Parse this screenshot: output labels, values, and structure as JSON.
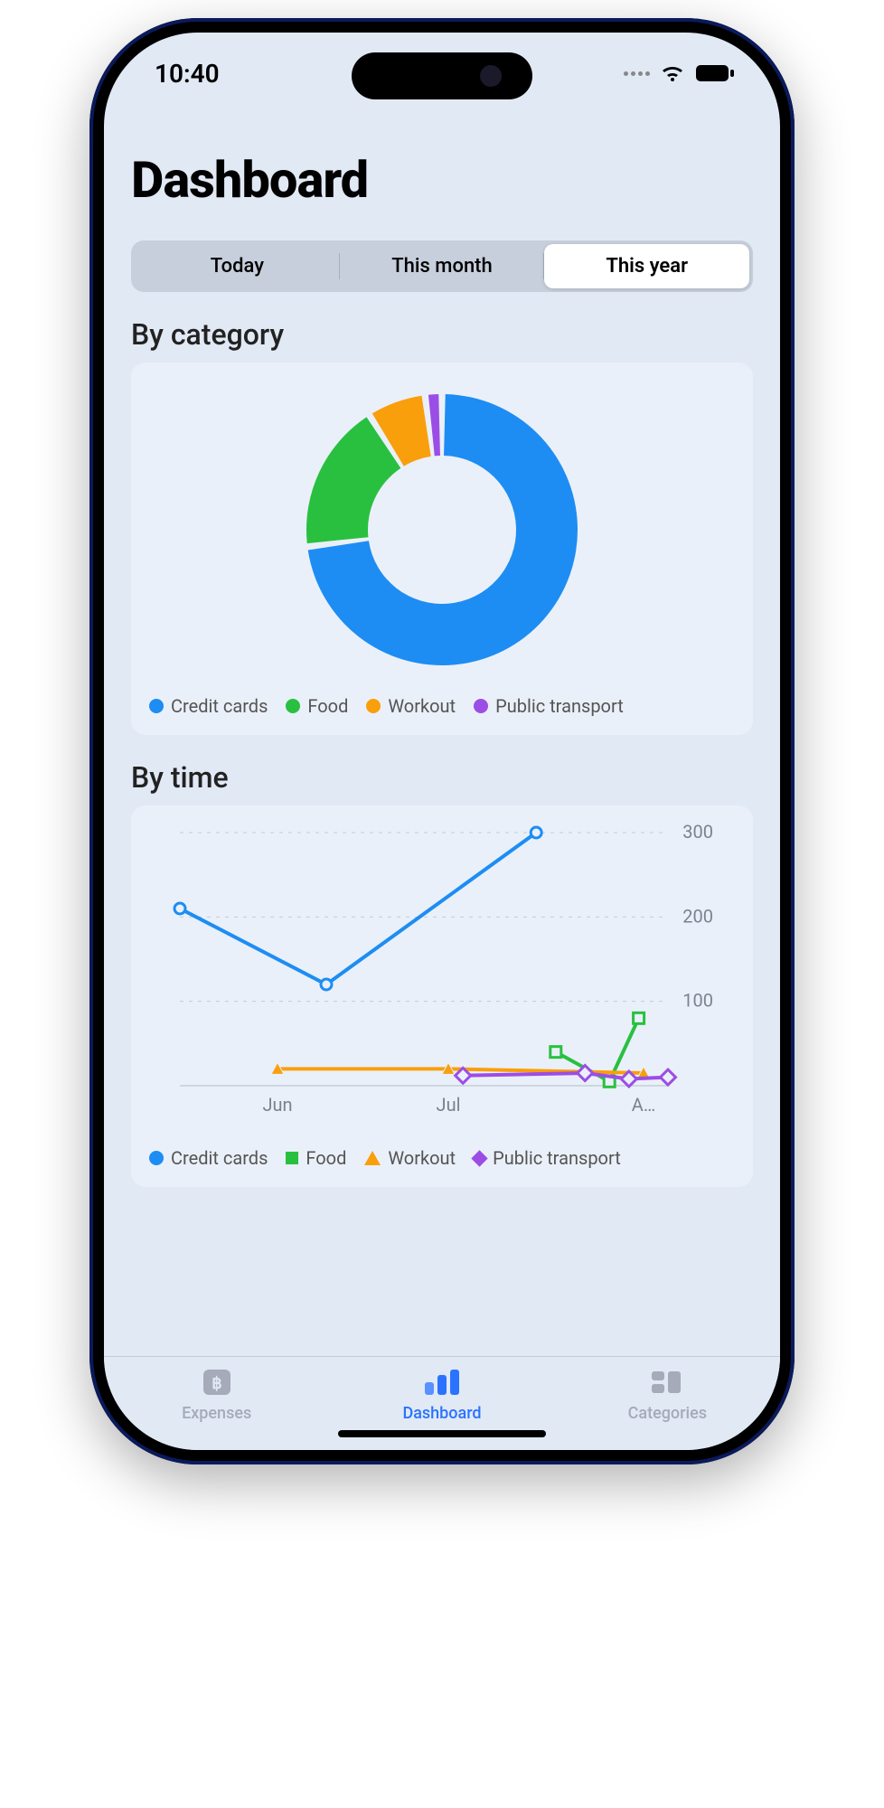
{
  "status": {
    "time": "10:40"
  },
  "title": "Dashboard",
  "segments": {
    "today": "Today",
    "month": "This month",
    "year": "This year",
    "active": 2
  },
  "sections": {
    "by_category": "By category",
    "by_time": "By time"
  },
  "categories": {
    "credit_cards": {
      "label": "Credit cards",
      "color": "#1d8df3"
    },
    "food": {
      "label": "Food",
      "color": "#29c040"
    },
    "workout": {
      "label": "Workout",
      "color": "#f99f0b"
    },
    "transport": {
      "label": "Public transport",
      "color": "#9b4ee5"
    }
  },
  "nav": {
    "expenses": {
      "label": "Expenses"
    },
    "dashboard": {
      "label": "Dashboard"
    },
    "categories": {
      "label": "Categories"
    }
  },
  "chart_data": [
    {
      "type": "pie",
      "title": "By category",
      "series": [
        {
          "name": "Credit cards",
          "value": 73,
          "color": "#1d8df3"
        },
        {
          "name": "Food",
          "value": 18,
          "color": "#29c040"
        },
        {
          "name": "Workout",
          "value": 7,
          "color": "#f99f0b"
        },
        {
          "name": "Public transport",
          "value": 2,
          "color": "#9b4ee5"
        }
      ]
    },
    {
      "type": "line",
      "title": "By time",
      "xlabel": "",
      "ylabel": "",
      "ylim": [
        0,
        300
      ],
      "yticks": [
        100,
        200,
        300
      ],
      "xticks": [
        "Jun",
        "Jul",
        "A…"
      ],
      "series": [
        {
          "name": "Credit cards",
          "color": "#1d8df3",
          "points": [
            {
              "x_label": "May-15",
              "xi": 0.0,
              "y": 210
            },
            {
              "x_label": "Jun-15",
              "xi": 0.3,
              "y": 120
            },
            {
              "x_label": "Jul-20",
              "xi": 0.73,
              "y": 300
            }
          ]
        },
        {
          "name": "Food",
          "color": "#29c040",
          "points": [
            {
              "x_label": "Jul-22",
              "xi": 0.77,
              "y": 40
            },
            {
              "x_label": "Jul-28",
              "xi": 0.88,
              "y": 5
            },
            {
              "x_label": "Aug-01",
              "xi": 0.94,
              "y": 80
            }
          ]
        },
        {
          "name": "Workout",
          "color": "#f99f0b",
          "points": [
            {
              "x_label": "Jun-01",
              "xi": 0.2,
              "y": 20
            },
            {
              "x_label": "Jul-01",
              "xi": 0.55,
              "y": 20
            },
            {
              "x_label": "Aug-01",
              "xi": 0.95,
              "y": 15
            }
          ]
        },
        {
          "name": "Public transport",
          "color": "#9b4ee5",
          "points": [
            {
              "x_label": "Jul-03",
              "xi": 0.58,
              "y": 12
            },
            {
              "x_label": "Jul-25",
              "xi": 0.83,
              "y": 15
            },
            {
              "x_label": "Jul-30",
              "xi": 0.92,
              "y": 8
            },
            {
              "x_label": "Aug-05",
              "xi": 1.0,
              "y": 10
            }
          ]
        }
      ]
    }
  ]
}
